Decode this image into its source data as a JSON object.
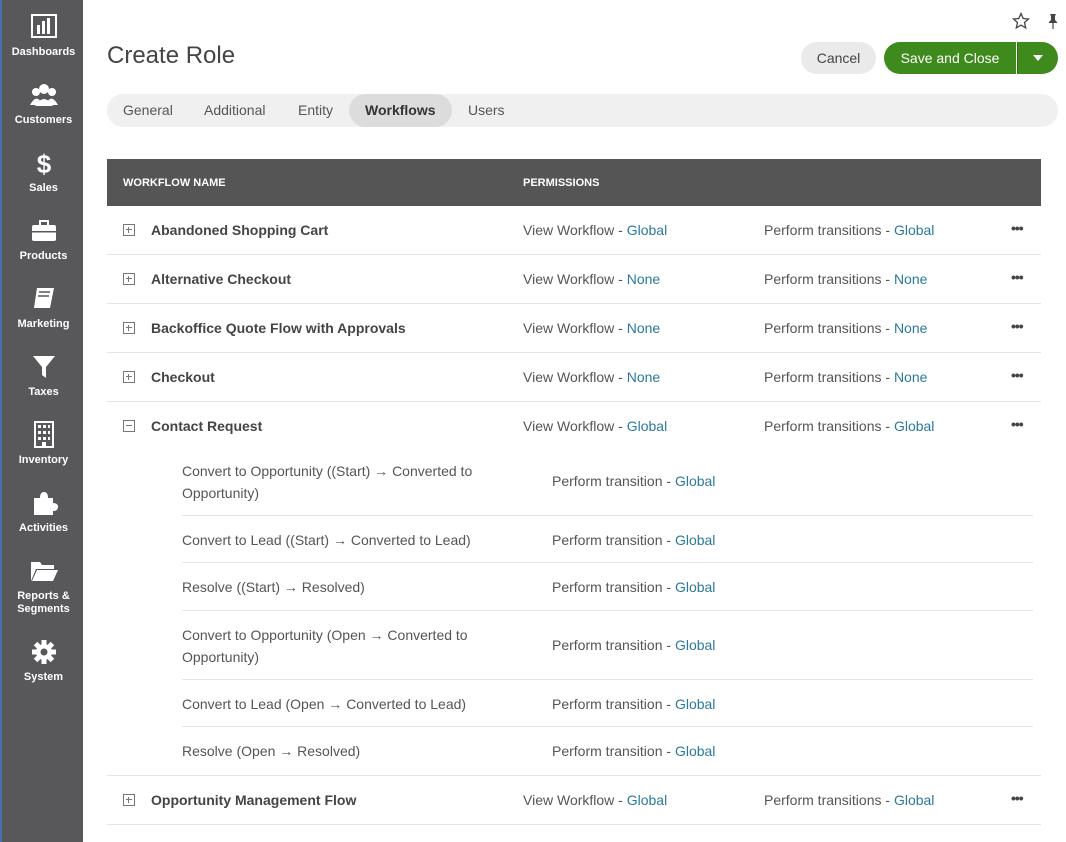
{
  "sidebar": {
    "items": [
      {
        "label": "Dashboards"
      },
      {
        "label": "Customers"
      },
      {
        "label": "Sales"
      },
      {
        "label": "Products"
      },
      {
        "label": "Marketing"
      },
      {
        "label": "Taxes"
      },
      {
        "label": "Inventory"
      },
      {
        "label": "Activities"
      },
      {
        "label": "Reports &\nSegments"
      },
      {
        "label": "System"
      }
    ]
  },
  "header": {
    "title": "Create Role",
    "cancel_label": "Cancel",
    "save_label": "Save and Close"
  },
  "tabs": [
    {
      "label": "General"
    },
    {
      "label": "Additional"
    },
    {
      "label": "Entity"
    },
    {
      "label": "Workflows"
    },
    {
      "label": "Users"
    }
  ],
  "grid": {
    "columns": [
      "WORKFLOW NAME",
      "PERMISSIONS"
    ],
    "view_prefix": "View Workflow - ",
    "perform_prefix": "Perform transitions - ",
    "transition_prefix": "Perform transition - ",
    "more": "•••",
    "rows": [
      {
        "name": "Abandoned Shopping Cart",
        "view": "Global",
        "perform": "Global"
      },
      {
        "name": "Alternative Checkout",
        "view": "None",
        "perform": "None"
      },
      {
        "name": "Backoffice Quote Flow with Approvals",
        "view": "None",
        "perform": "None"
      },
      {
        "name": "Checkout",
        "view": "None",
        "perform": "None"
      },
      {
        "name": "Contact Request",
        "view": "Global",
        "perform": "Global"
      },
      {
        "name": "Opportunity Management Flow",
        "view": "Global",
        "perform": "Global"
      }
    ],
    "transitions": [
      {
        "name": "Convert to Opportunity ((Start) → Converted to Opportunity)",
        "level": "Global"
      },
      {
        "name": "Convert to Lead ((Start) → Converted to Lead)",
        "level": "Global"
      },
      {
        "name": "Resolve ((Start) → Resolved)",
        "level": "Global"
      },
      {
        "name": "Convert to Opportunity (Open → Converted to Opportunity)",
        "level": "Global"
      },
      {
        "name": "Convert to Lead (Open → Converted to Lead)",
        "level": "Global"
      },
      {
        "name": "Resolve (Open → Resolved)",
        "level": "Global"
      }
    ]
  },
  "colors": {
    "accent": "#3e8a1c",
    "link": "#2b7a9b",
    "sidebar": "#58585a"
  }
}
